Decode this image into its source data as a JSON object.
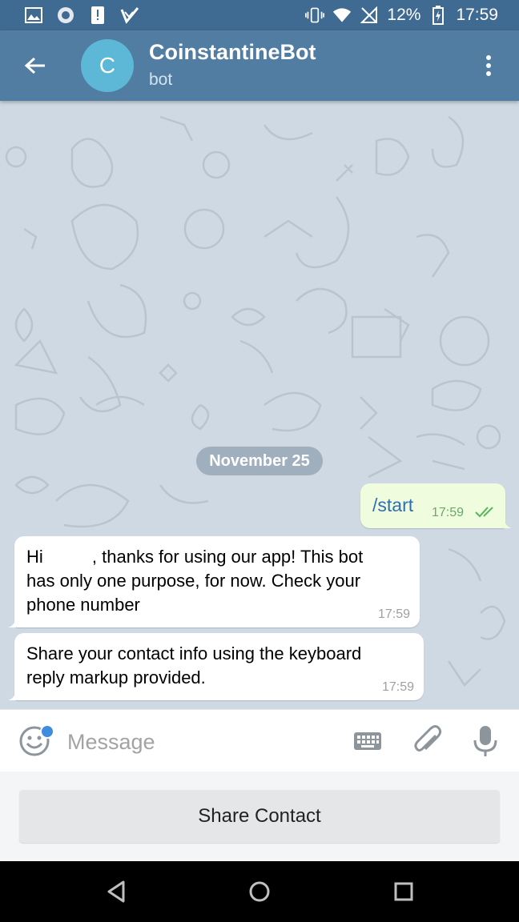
{
  "status_bar": {
    "battery": "12%",
    "time": "17:59",
    "icons": [
      "image-icon",
      "sync-icon",
      "sim-alert-icon",
      "checkbox-icon",
      "vibrate-icon",
      "wifi-icon",
      "no-signal-icon",
      "battery-charging-icon"
    ]
  },
  "header": {
    "avatar_letter": "C",
    "title": "CoinstantineBot",
    "subtitle": "bot",
    "back_icon": "arrow-left-icon",
    "menu_icon": "more-vertical-icon"
  },
  "chat": {
    "date_chip": "November 25",
    "messages": [
      {
        "direction": "out",
        "text": "/start",
        "time": "17:59",
        "status": "read"
      },
      {
        "direction": "in",
        "lines": [
          "Hi          , thanks for using our app! This bot",
          "has only one purpose, for now. Check your",
          "phone number"
        ],
        "time": "17:59"
      },
      {
        "direction": "in",
        "lines": [
          "Share your contact info using the keyboard",
          "reply markup provided."
        ],
        "time": "17:59"
      }
    ]
  },
  "input": {
    "placeholder": "Message",
    "value": "",
    "icons": [
      "emoji-icon",
      "keyboard-icon",
      "paperclip-icon",
      "microphone-icon"
    ]
  },
  "reply_keyboard": {
    "button": "Share Contact"
  },
  "colors": {
    "header": "#517da2",
    "status_bar": "#3f6a92",
    "chat_bg": "#cfd9e3",
    "outgoing_bubble": "#effdde",
    "accent": "#3d8de0"
  }
}
